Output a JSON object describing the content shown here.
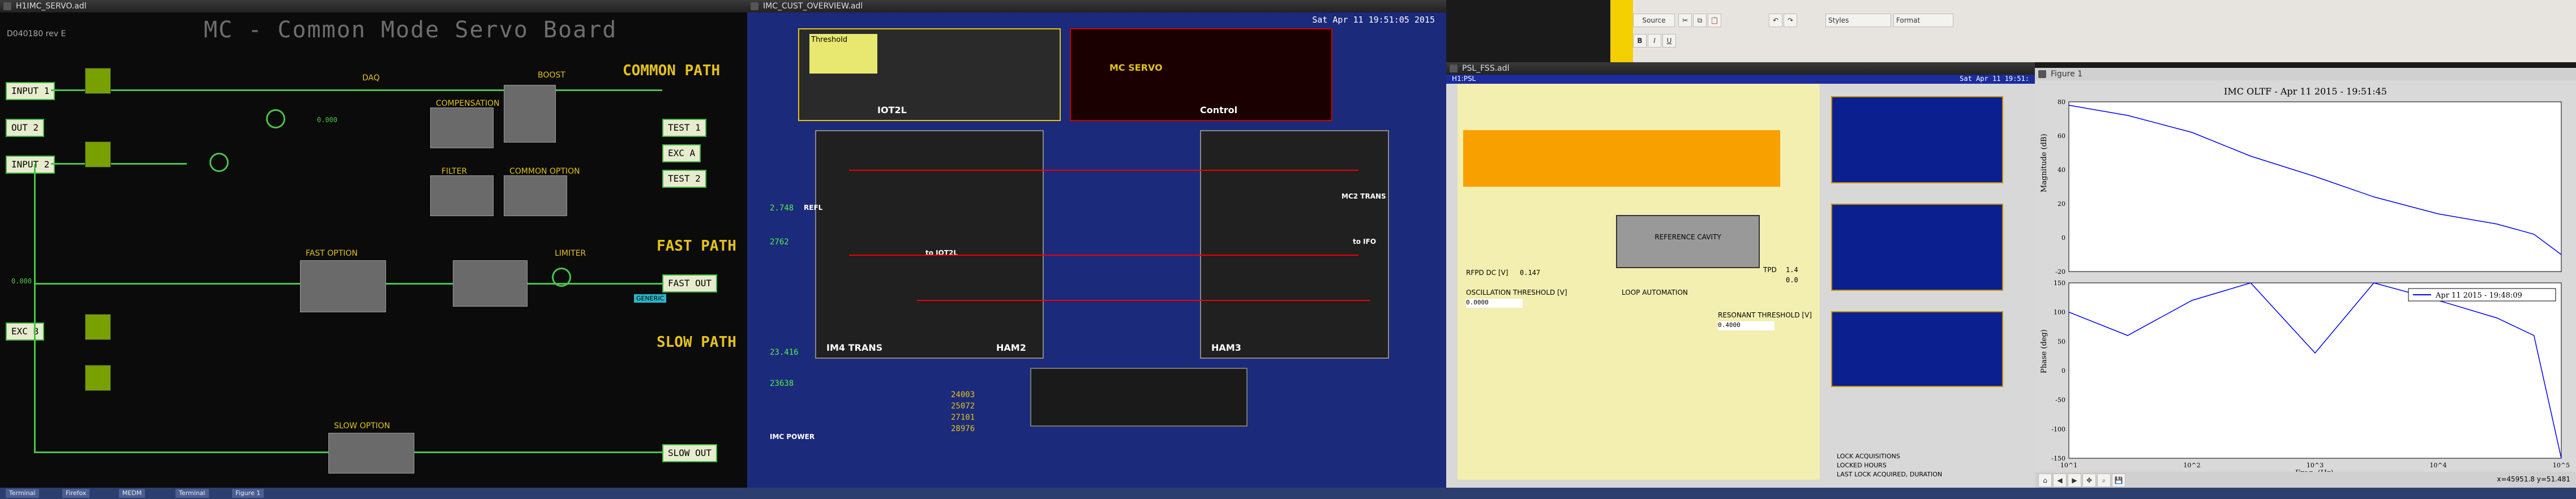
{
  "servo_window": {
    "title": "H1IMC_SERVO.adl",
    "board_title": "MC - Common Mode Servo Board",
    "revision": "D040180 rev E",
    "sections": {
      "common": "COMMON PATH",
      "fast": "FAST PATH",
      "slow": "SLOW PATH"
    },
    "io": {
      "input1": "INPUT 1",
      "out2": "OUT 2",
      "input2": "INPUT 2",
      "exc_b": "EXC B",
      "test1": "TEST 1",
      "exc_a": "EXC A",
      "test2": "TEST 2",
      "fast_out": "FAST OUT",
      "slow_out": "SLOW OUT"
    },
    "labels": {
      "boost": "BOOST",
      "compensation": "COMPENSATION",
      "filter": "FILTER",
      "common_option": "COMMON OPTION",
      "fast_option": "FAST OPTION",
      "limiter": "LIMITER",
      "slow_option": "SLOW OPTION",
      "daq": "DAQ",
      "generic": "GENERIC"
    },
    "values": {
      "v1": "0.000",
      "v2": "0.000"
    }
  },
  "overview_window": {
    "title": "IMC_CUST_OVERVIEW.adl",
    "clock": "Sat Apr 11 19:51:05 2015",
    "labels": {
      "imc_servo": "MC SERVO",
      "control": "Control",
      "iot2l": "IOT2L",
      "ham2": "HAM2",
      "ham3": "HAM3",
      "mc2_trans": "MC2 TRANS",
      "im4_trans": "IM4 TRANS",
      "to_iot2l": "to IOT2L",
      "refl": "REFL",
      "to_ifo": "to IFO",
      "imc_power": "IMC POWER",
      "threshold": "Threshold"
    },
    "numbers": [
      "2.748",
      "2762",
      "23.416",
      "23638",
      "24003",
      "25072",
      "27101",
      "28976"
    ]
  },
  "psl_window": {
    "title": "PSL_FSS.adl",
    "header_left": "H1:PSL",
    "clock": "Sat Apr 11 19:51:",
    "labels": {
      "reference_cavity": "REFERENCE CAVITY",
      "loop_automation": "LOOP AUTOMATION",
      "oscillation_threshold": "OSCILLATION THRESHOLD [V]",
      "resonant_threshold": "RESONANT THRESHOLD [V]",
      "rfpd_dc": "RFPD DC [V]",
      "tpd": "TPD",
      "lock_acquisitions": "LOCK ACQUISITIONS",
      "locked_hours": "LOCKED HOURS",
      "last_lock": "LAST LOCK ACQUIRED, DURATION"
    },
    "values": {
      "osc": "0.0000",
      "res": "0.4000",
      "rfpd": "0.147",
      "tpd1": "1.4",
      "tpd2": "0.0"
    }
  },
  "plot_window": {
    "title": "Figure 1",
    "plot_title": "IMC OLTF - Apr 11 2015 - 19:51:45",
    "ylabel_top": "Magnitude (dB)",
    "ylabel_bottom": "Phase (deg)",
    "xlabel": "Freq. (Hz)",
    "legend": "Apr 11 2015 - 19:48:09",
    "status": "x=45951.8  y=51.481",
    "line_color": "#0000ff"
  },
  "chart_data": [
    {
      "type": "line",
      "title": "IMC OLTF - Apr 11 2015 - 19:51:45",
      "xlabel": "Freq. (Hz)",
      "ylabel": "Magnitude (dB)",
      "xscale": "log",
      "xlim": [
        10,
        100000
      ],
      "x": [
        10,
        30,
        100,
        300,
        1000,
        3000,
        10000,
        30000,
        60000,
        100000
      ],
      "series": [
        {
          "name": "Apr 11 2015 - 19:48:09",
          "values": [
            78,
            72,
            62,
            48,
            36,
            24,
            14,
            8,
            2,
            -10
          ]
        }
      ],
      "yticks": [
        -20,
        0,
        20,
        40,
        60,
        80
      ]
    },
    {
      "type": "line",
      "xlabel": "Freq. (Hz)",
      "ylabel": "Phase (deg)",
      "xscale": "log",
      "xlim": [
        10,
        100000
      ],
      "x": [
        10,
        30,
        100,
        300,
        1000,
        3000,
        10000,
        30000,
        60000,
        100000
      ],
      "series": [
        {
          "name": "Apr 11 2015 - 19:48:09",
          "values": [
            100,
            60,
            120,
            150,
            30,
            150,
            120,
            90,
            60,
            -150
          ]
        }
      ],
      "yticks": [
        -150,
        -100,
        -50,
        0,
        50,
        100,
        150
      ]
    }
  ],
  "editor": {
    "source_button": "Source",
    "styles": "Styles",
    "format": "Format"
  },
  "taskbar": [
    "Terminal",
    "Firefox",
    "MEDM",
    "Terminal",
    "Figure 1"
  ]
}
